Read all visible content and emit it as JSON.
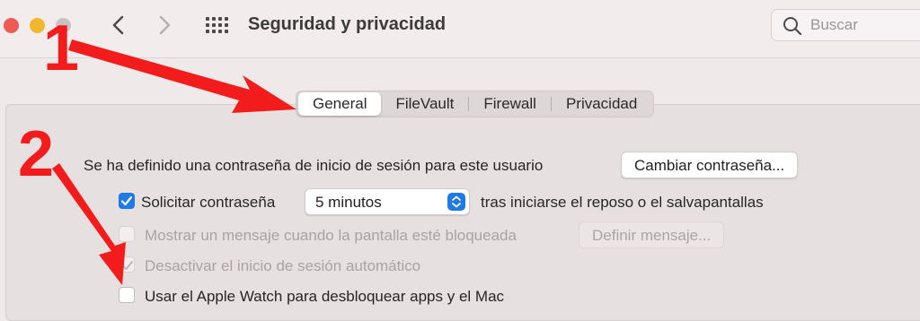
{
  "window": {
    "title": "Seguridad y privacidad",
    "search": {
      "placeholder": "Buscar",
      "value": ""
    }
  },
  "tabs": [
    {
      "label": "General",
      "selected": true
    },
    {
      "label": "FileVault",
      "selected": false
    },
    {
      "label": "Firewall",
      "selected": false
    },
    {
      "label": "Privacidad",
      "selected": false
    }
  ],
  "general": {
    "password_text": "Se ha definido una contraseña de inicio de sesión para este usuario",
    "change_password_label": "Cambiar contraseña...",
    "require_password": {
      "label": "Solicitar contraseña",
      "checked": true,
      "interval": "5 minutos",
      "suffix": "tras iniciarse el reposo o el salvapantallas"
    },
    "show_message": {
      "label": "Mostrar un mensaje cuando la pantalla esté bloqueada",
      "checked": false,
      "enabled": false,
      "button_label": "Definir mensaje..."
    },
    "disable_autologin": {
      "label": "Desactivar el inicio de sesión automático",
      "checked": true,
      "enabled": false
    },
    "apple_watch": {
      "label": "Usar el Apple Watch para desbloquear apps y el Mac",
      "checked": false
    }
  },
  "annotations": [
    {
      "label": "1",
      "color": "#f21c1c"
    },
    {
      "label": "2",
      "color": "#f21c1c"
    }
  ],
  "icons": {
    "close": "close-dot-icon",
    "minimize": "minimize-dot-icon",
    "zoom": "zoom-dot-icon",
    "back": "chevron-left-icon",
    "forward": "chevron-right-icon",
    "grid": "grid-icon",
    "search": "search-icon"
  }
}
